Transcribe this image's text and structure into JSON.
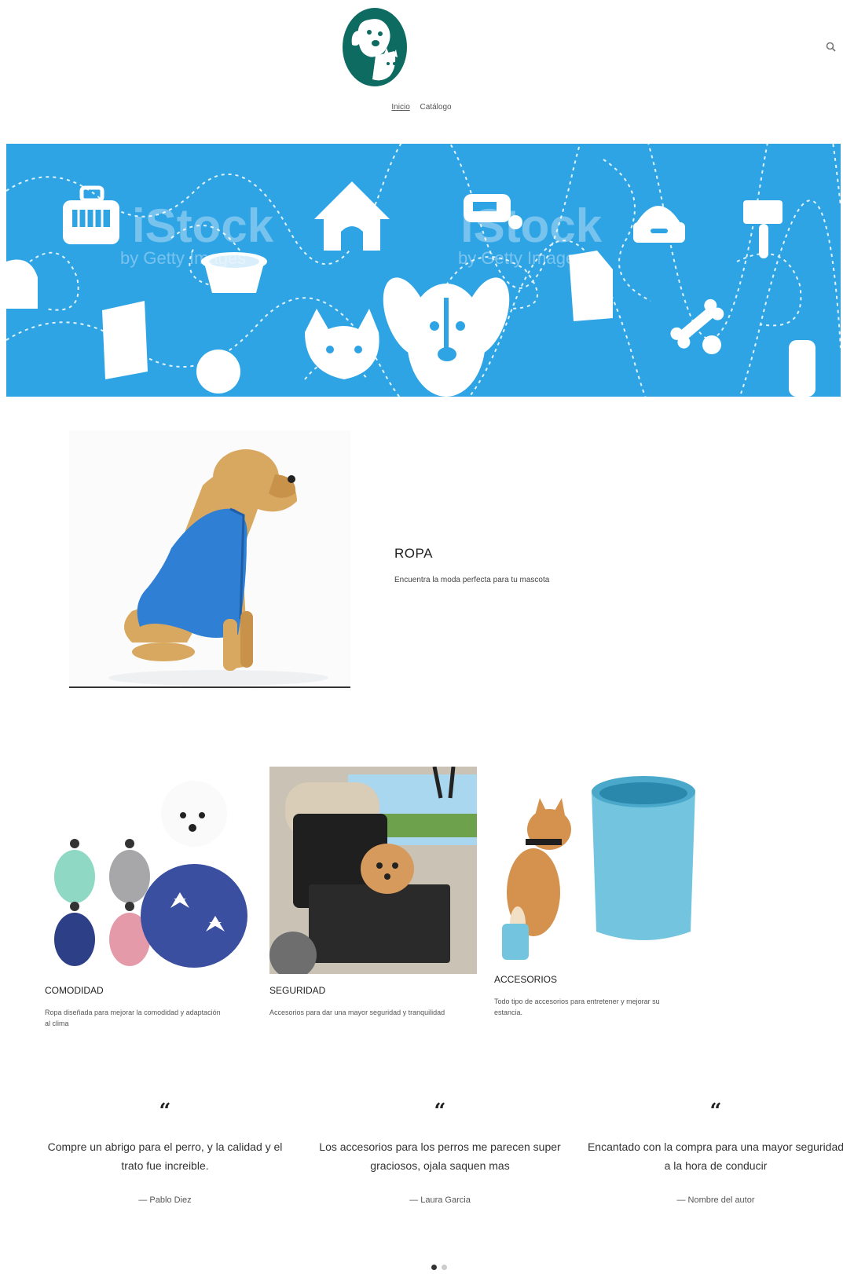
{
  "header": {
    "nav": [
      {
        "label": "Inicio",
        "active": true
      },
      {
        "label": "Catálogo",
        "active": false
      }
    ]
  },
  "featured": {
    "title": "ROPA",
    "text": "Encuentra la moda perfecta para tu mascota"
  },
  "collections": [
    {
      "title": "COMODIDAD",
      "text": "Ropa diseñada para mejorar la comodidad y adaptación al clima"
    },
    {
      "title": "SEGURIDAD",
      "text": "Accesorios para dar una mayor seguridad y tranquilidad"
    },
    {
      "title": "ACCESORIOS",
      "text": "Todo tipo de accesorios para entretener y mejorar su estancia."
    }
  ],
  "testimonials": [
    {
      "quote": "Compre un abrigo para el perro, y la calidad y el trato fue increible.",
      "author": "— Pablo Diez"
    },
    {
      "quote": "Los accesorios para los perros me parecen super graciosos, ojala saquen mas",
      "author": "— Laura Garcia"
    },
    {
      "quote": "Encantado con la compra para una mayor seguridad a la hora de conducir",
      "author": "— Nombre del autor"
    }
  ],
  "quote_mark": "“",
  "hero_watermarks": [
    "iStock",
    "by Getty Images",
    "iStock",
    "by Getty Images"
  ],
  "colors": {
    "hero_bg": "#2fa4e5",
    "logo": "#0e6b62"
  },
  "slider": {
    "count": 2,
    "active": 0
  }
}
